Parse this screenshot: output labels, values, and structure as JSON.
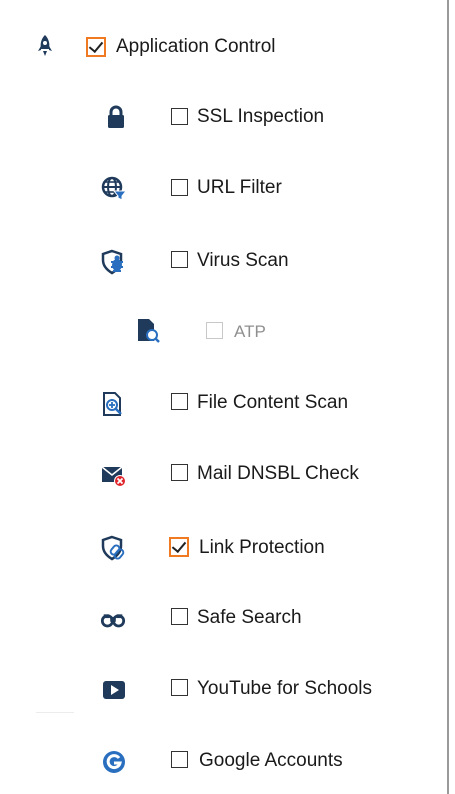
{
  "items": [
    {
      "label": "Application Control",
      "icon": "rocket-icon",
      "checked": true,
      "disabled": false
    },
    {
      "label": "SSL Inspection",
      "icon": "lock-icon",
      "checked": false,
      "disabled": false
    },
    {
      "label": "URL Filter",
      "icon": "globe-filter-icon",
      "checked": false,
      "disabled": false
    },
    {
      "label": "Virus Scan",
      "icon": "shield-bug-icon",
      "checked": false,
      "disabled": false
    },
    {
      "label": "ATP",
      "icon": "file-search-icon",
      "checked": false,
      "disabled": true
    },
    {
      "label": "File Content Scan",
      "icon": "document-zoom-icon",
      "checked": false,
      "disabled": false
    },
    {
      "label": "Mail DNSBL Check",
      "icon": "mail-block-icon",
      "checked": false,
      "disabled": false
    },
    {
      "label": "Link Protection",
      "icon": "shield-link-icon",
      "checked": true,
      "disabled": false
    },
    {
      "label": "Safe Search",
      "icon": "binoculars-icon",
      "checked": false,
      "disabled": false
    },
    {
      "label": "YouTube for Schools",
      "icon": "play-icon",
      "checked": false,
      "disabled": false
    },
    {
      "label": "Google Accounts",
      "icon": "google-icon",
      "checked": false,
      "disabled": false
    }
  ],
  "colors": {
    "accent": "#f07a22",
    "icon_dark": "#1f3a5a",
    "icon_blue": "#2a6fbf",
    "danger": "#e0242a"
  }
}
